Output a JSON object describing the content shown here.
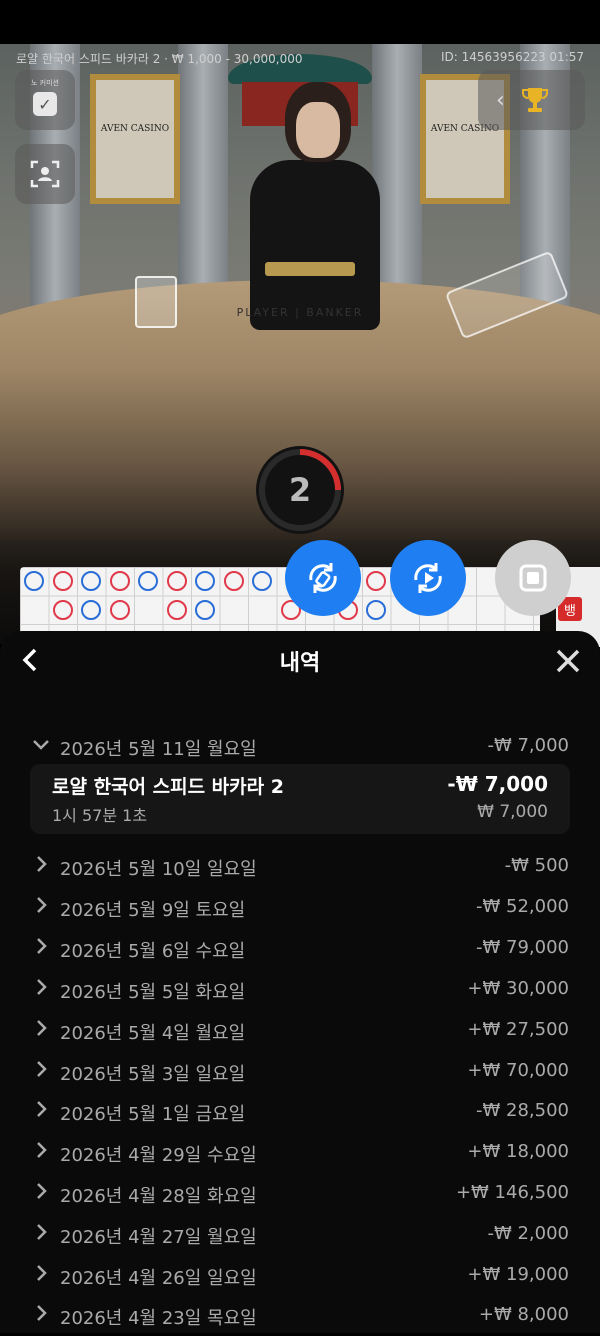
{
  "stream": {
    "info_left": "로얄 한국어 스피드 바카라 2 · ₩ 1,000 - 30,000,000",
    "info_right": "ID: 14563956223 01:57",
    "tiny_label": "노 커미션",
    "table_label": "PLAYER | BANKER",
    "casino_brand": "AVEN CASINO",
    "timer_value": "2"
  },
  "controls": {
    "left_buttons": [
      "checkbox-icon",
      "user-frame-icon"
    ],
    "fabs": [
      {
        "name": "swap-table-button",
        "icon": "swap-icon",
        "color": "#1e7ef2"
      },
      {
        "name": "autoplay-button",
        "icon": "play-refresh-icon",
        "color": "#1e7ef2"
      },
      {
        "name": "stop-button",
        "icon": "stop-icon",
        "color": "#cfcfcf"
      }
    ],
    "side_label": "뱅"
  },
  "history": {
    "title": "내역",
    "expanded": {
      "date": "2026년 5월 11일 월요일",
      "total": "-₩ 7,000",
      "game_name": "로얄 한국어 스피드 바카라 2",
      "game_result": "-₩ 7,000",
      "time": "1시 57분 1초",
      "bet": "₩ 7,000"
    },
    "days": [
      {
        "date": "2026년 5월 10일 일요일",
        "amount": "-₩ 500"
      },
      {
        "date": "2026년 5월 9일 토요일",
        "amount": "-₩ 52,000"
      },
      {
        "date": "2026년 5월 6일 수요일",
        "amount": "-₩ 79,000"
      },
      {
        "date": "2026년 5월 5일 화요일",
        "amount": "+₩ 30,000"
      },
      {
        "date": "2026년 5월 4일 월요일",
        "amount": "+₩ 27,500"
      },
      {
        "date": "2026년 5월 3일 일요일",
        "amount": "+₩ 70,000"
      },
      {
        "date": "2026년 5월 1일 금요일",
        "amount": "-₩ 28,500"
      },
      {
        "date": "2026년 4월 29일 수요일",
        "amount": "+₩ 18,000"
      },
      {
        "date": "2026년 4월 28일 화요일",
        "amount": "+₩ 146,500"
      },
      {
        "date": "2026년 4월 27일 월요일",
        "amount": "-₩ 2,000"
      },
      {
        "date": "2026년 4월 26일 일요일",
        "amount": "+₩ 19,000"
      },
      {
        "date": "2026년 4월 23일 목요일",
        "amount": "+₩ 8,000"
      }
    ]
  },
  "colors": {
    "accent_blue": "#1e7ef2",
    "banker_red": "#e0394a",
    "player_blue": "#2a6dd6",
    "timer_arc": "#d32f2f"
  }
}
